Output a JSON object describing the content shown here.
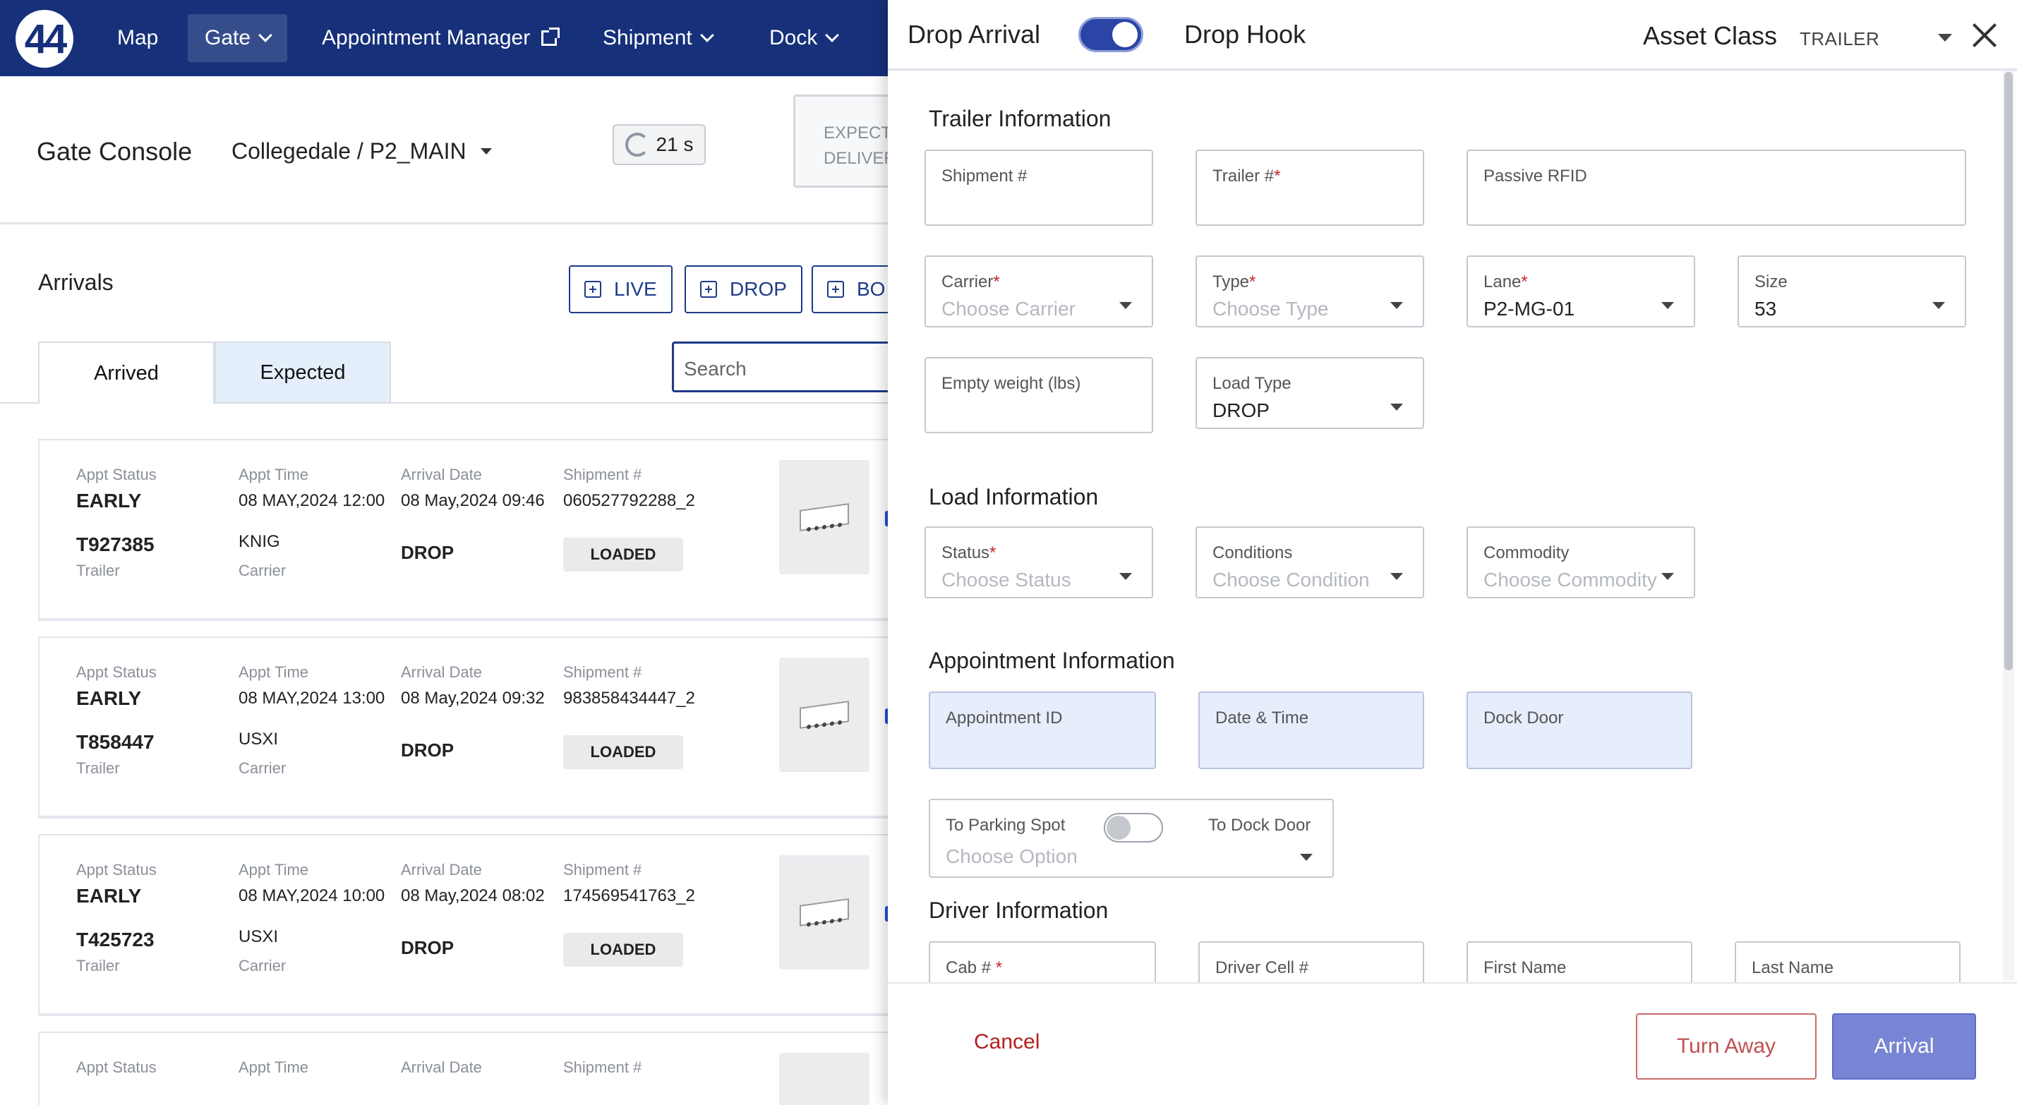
{
  "nav": {
    "logo_text": "44",
    "items": [
      {
        "label": "Map"
      },
      {
        "label": "Gate"
      },
      {
        "label": "Appointment Manager"
      },
      {
        "label": "Shipment"
      },
      {
        "label": "Dock"
      }
    ]
  },
  "console": {
    "title": "Gate Console",
    "site": "Collegedale / P2_MAIN",
    "refresh": "21 s",
    "expected_card_line1": "EXPECTI",
    "expected_card_line2": "DELIVER"
  },
  "arrivals": {
    "title": "Arrivals",
    "actions": [
      "LIVE",
      "DROP",
      "BO"
    ],
    "tabs": [
      "Arrived",
      "Expected"
    ],
    "search_placeholder": "Search",
    "labels": {
      "appt_status": "Appt Status",
      "appt_time": "Appt Time",
      "arrival_date": "Arrival Date",
      "shipment": "Shipment #",
      "trailer": "Trailer",
      "carrier": "Carrier"
    },
    "rows": [
      {
        "status": "EARLY",
        "appt_time": "08 MAY,2024 12:00",
        "arrival_date": "08 May,2024 09:46",
        "shipment": "060527792288_2",
        "trailer": "T927385",
        "carrier": "KNIG",
        "load": "DROP",
        "badge": "LOADED"
      },
      {
        "status": "EARLY",
        "appt_time": "08 MAY,2024 13:00",
        "arrival_date": "08 May,2024 09:32",
        "shipment": "983858434447_2",
        "trailer": "T858447",
        "carrier": "USXI",
        "load": "DROP",
        "badge": "LOADED"
      },
      {
        "status": "EARLY",
        "appt_time": "08 MAY,2024 10:00",
        "arrival_date": "08 May,2024 08:02",
        "shipment": "174569541763_2",
        "trailer": "T425723",
        "carrier": "USXI",
        "load": "DROP",
        "badge": "LOADED"
      }
    ]
  },
  "panel": {
    "drop_arrival": "Drop Arrival",
    "drop_hook": "Drop Hook",
    "asset_class_label": "Asset Class",
    "asset_class_value": "TRAILER",
    "trailer_section": "Trailer Information",
    "load_section": "Load Information",
    "appointment_section": "Appointment Information",
    "driver_section": "Driver Information",
    "fields": {
      "shipment": {
        "label": "Shipment #"
      },
      "trailer": {
        "label": "Trailer #",
        "req": "*"
      },
      "rfid": {
        "label": "Passive RFID"
      },
      "carrier": {
        "label": "Carrier",
        "req": "*",
        "placeholder": "Choose Carrier"
      },
      "type": {
        "label": "Type",
        "req": "*",
        "placeholder": "Choose Type"
      },
      "lane": {
        "label": "Lane",
        "req": "*",
        "value": "P2-MG-01"
      },
      "size": {
        "label": "Size",
        "value": "53"
      },
      "empty_weight": {
        "label": "Empty weight (lbs)"
      },
      "load_type": {
        "label": "Load Type",
        "value": "DROP"
      },
      "status": {
        "label": "Status",
        "req": "*",
        "placeholder": "Choose Status"
      },
      "conditions": {
        "label": "Conditions",
        "placeholder": "Choose Condition"
      },
      "commodity": {
        "label": "Commodity",
        "placeholder": "Choose Commodity"
      },
      "appointment_id": {
        "label": "Appointment ID"
      },
      "date_time": {
        "label": "Date & Time"
      },
      "dock_door": {
        "label": "Dock Door"
      },
      "to_parking": {
        "label": "To Parking Spot"
      },
      "to_dock": {
        "label": "To Dock Door"
      },
      "move_option": {
        "placeholder": "Choose Option"
      },
      "cab": {
        "label": "Cab # ",
        "req": "*"
      },
      "driver_cell": {
        "label": "Driver Cell #"
      },
      "first_name": {
        "label": "First Name"
      },
      "last_name": {
        "label": "Last Name"
      }
    },
    "footer": {
      "cancel": "Cancel",
      "turn_away": "Turn Away",
      "arrival": "Arrival"
    }
  },
  "colors": {
    "nav_bg": "#16307a",
    "primary": "#1e3a8a",
    "toggle_on": "#2b45a6",
    "arrival_btn": "#7885d4",
    "cancel_red": "#b32020",
    "appointment_field_bg": "#e6edfb"
  }
}
